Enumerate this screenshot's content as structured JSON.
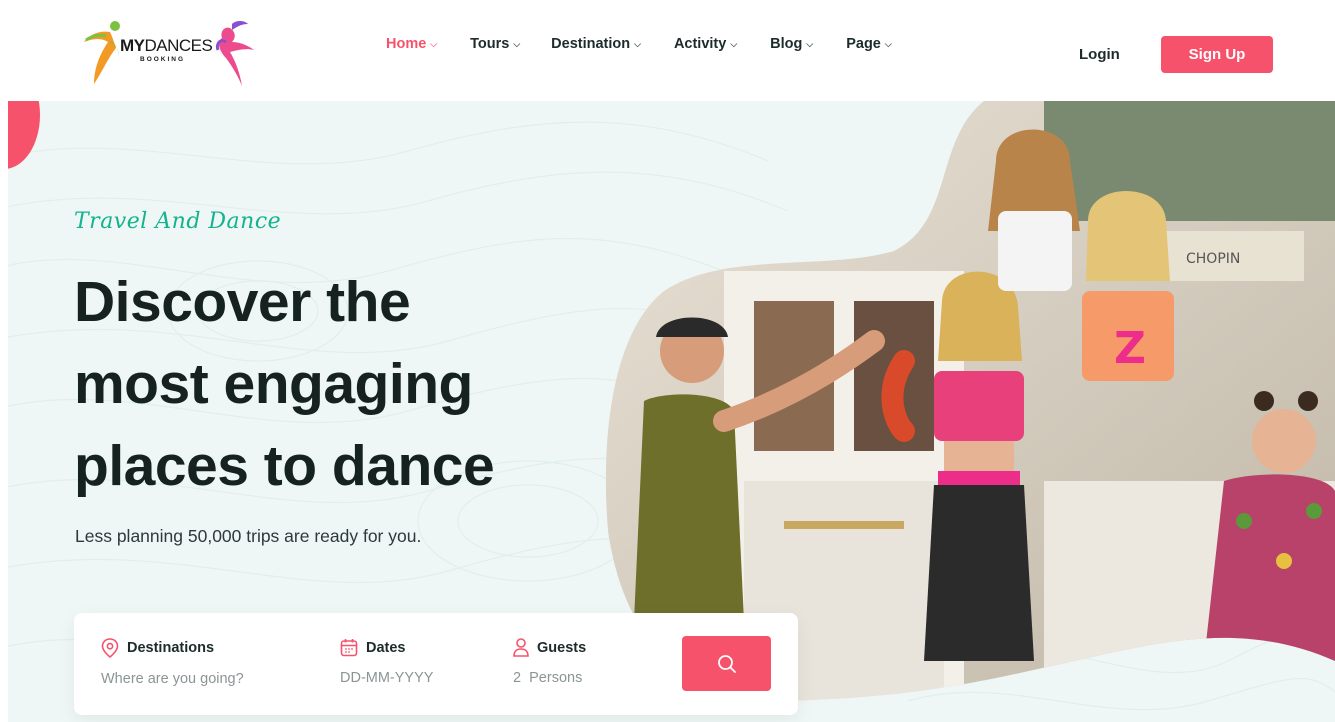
{
  "brand": {
    "name_bold": "MY",
    "name_light": "DANCES",
    "sub": "BOOKING",
    "colors": {
      "accent": "#f7526b",
      "teal": "#14b38e",
      "yellow": "#fbc93e"
    }
  },
  "nav": {
    "items": [
      {
        "label": "Home",
        "active": true
      },
      {
        "label": "Tours",
        "active": false
      },
      {
        "label": "Destination",
        "active": false
      },
      {
        "label": "Activity",
        "active": false
      },
      {
        "label": "Blog",
        "active": false
      },
      {
        "label": "Page",
        "active": false
      }
    ],
    "chevron": "⌵"
  },
  "auth": {
    "login": "Login",
    "signup": "Sign Up"
  },
  "hero": {
    "tagline": "Travel And Dance",
    "headline_1": "Discover the",
    "headline_2": "most engaging",
    "headline_3": "places to dance",
    "subtitle": "Less planning 50,000 trips are ready for you.",
    "image_icon": "dancers-photo"
  },
  "search": {
    "destinations": {
      "label": "Destinations",
      "placeholder": "Where are you going?",
      "icon": "location-pin-icon"
    },
    "dates": {
      "label": "Dates",
      "placeholder": "DD-MM-YYYY",
      "icon": "calendar-icon"
    },
    "guests": {
      "label": "Guests",
      "count": "2",
      "unit": "Persons",
      "icon": "user-icon"
    },
    "button_icon": "search-icon"
  }
}
